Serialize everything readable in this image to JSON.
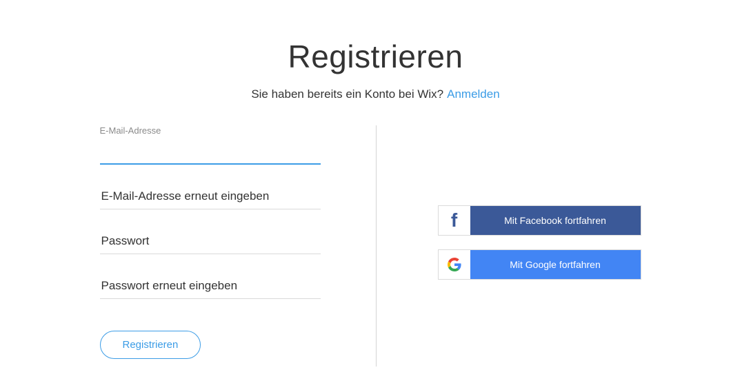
{
  "title": "Registrieren",
  "subtitle": {
    "text": "Sie haben bereits ein Konto bei Wix?",
    "link_label": "Anmelden"
  },
  "form": {
    "email": {
      "label": "E-Mail-Adresse",
      "value": "",
      "placeholder": ""
    },
    "email_confirm": {
      "placeholder": "E-Mail-Adresse erneut eingeben"
    },
    "password": {
      "placeholder": "Passwort"
    },
    "password_confirm": {
      "placeholder": "Passwort erneut eingeben"
    },
    "submit_label": "Registrieren"
  },
  "social": {
    "facebook_label": "Mit Facebook fortfahren",
    "google_label": "Mit Google fortfahren"
  }
}
